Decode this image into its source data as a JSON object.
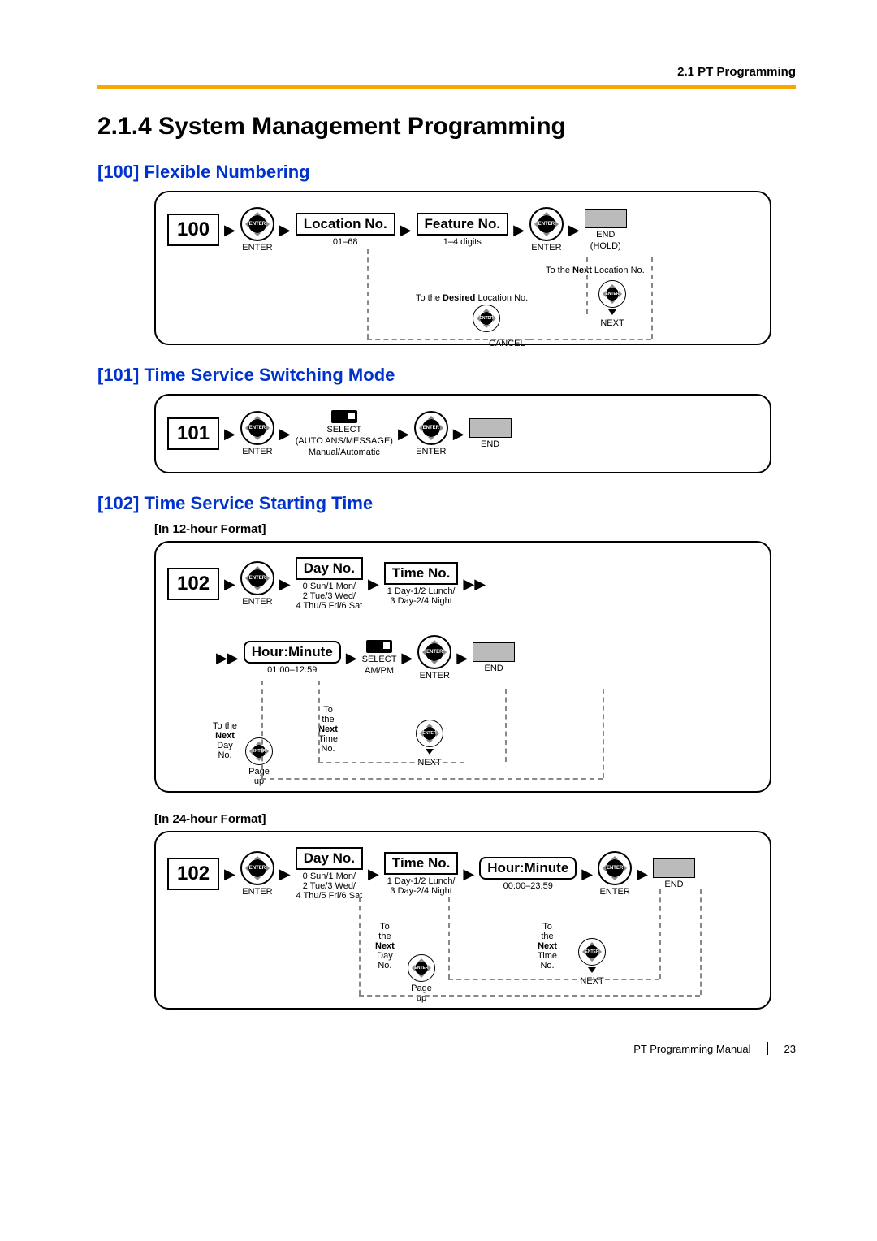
{
  "header": {
    "section": "2.1 PT Programming"
  },
  "title": "2.1.4   System Management Programming",
  "sections": {
    "s100": {
      "heading": "[100] Flexible Numbering",
      "code": "100",
      "enter": "ENTER",
      "location": "Location No.",
      "location_range": "01–68",
      "feature": "Feature No.",
      "feature_range": "1–4 digits",
      "end": "END",
      "hold": "(HOLD)",
      "to_next_location": "To the Next Location No.",
      "to_desired_location": "To the Desired Location No.",
      "cancel": "CANCEL",
      "next": "NEXT"
    },
    "s101": {
      "heading": "[101] Time Service Switching Mode",
      "code": "101",
      "enter": "ENTER",
      "select": "SELECT",
      "auto_ans": "(AUTO ANS/MESSAGE)",
      "manual_auto": "Manual/Automatic",
      "end": "END"
    },
    "s102": {
      "heading": "[102] Time Service Starting Time",
      "format12": "[In 12-hour Format]",
      "format24": "[In 24-hour Format]",
      "code": "102",
      "enter": "ENTER",
      "day_no": "Day No.",
      "day_list": "0 Sun/1 Mon/\n2 Tue/3 Wed/\n4 Thu/5 Fri/6 Sat",
      "time_no": "Time No.",
      "time_list": "1 Day-1/2 Lunch/\n3 Day-2/4 Night",
      "hour_minute": "Hour:Minute",
      "hm_range12": "01:00–12:59",
      "hm_range24": "00:00–23:59",
      "select": "SELECT",
      "ampm": "AM/PM",
      "end": "END",
      "to_next_time": "To the Next Time No.",
      "to_next_day": "To the Next Day No.",
      "next": "NEXT",
      "page_up": "Page up"
    }
  },
  "footer": {
    "manual": "PT Programming Manual",
    "page": "23"
  },
  "icons": {
    "enter_inner": "ENTER"
  }
}
